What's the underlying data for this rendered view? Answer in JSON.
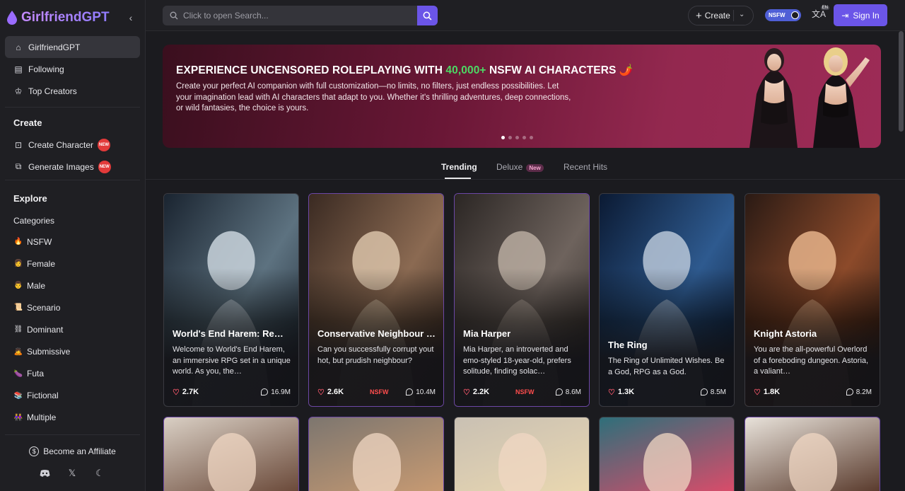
{
  "brand": {
    "name": "GirlfriendGPT"
  },
  "sidebar": {
    "top_items": [
      {
        "label": "GirlfriendGPT",
        "icon": "home-icon"
      },
      {
        "label": "Following",
        "icon": "following-icon"
      },
      {
        "label": "Top Creators",
        "icon": "award-icon"
      }
    ],
    "create_title": "Create",
    "create_items": [
      {
        "label": "Create Character",
        "badge": "NEW"
      },
      {
        "label": "Generate Images",
        "badge": "NEW"
      }
    ],
    "explore_title": "Explore",
    "categories_label": "Categories",
    "categories": [
      {
        "emoji": "🔥",
        "label": "NSFW"
      },
      {
        "emoji": "👩",
        "label": "Female"
      },
      {
        "emoji": "👨",
        "label": "Male"
      },
      {
        "emoji": "📜",
        "label": "Scenario"
      },
      {
        "emoji": "⛓",
        "label": "Dominant"
      },
      {
        "emoji": "🙇",
        "label": "Submissive"
      },
      {
        "emoji": "🍆",
        "label": "Futa"
      },
      {
        "emoji": "📚",
        "label": "Fictional"
      },
      {
        "emoji": "👭",
        "label": "Multiple"
      }
    ],
    "affiliate": "Become an Affiliate"
  },
  "topbar": {
    "search_placeholder": "Click to open Search...",
    "create_label": "Create",
    "nsfw_label": "NSFW",
    "lang_badge": "EN",
    "signin_label": "Sign In"
  },
  "hero": {
    "title_before": "EXPERIENCE UNCENSORED ROLEPLAYING WITH ",
    "title_highlight": "40,000+",
    "title_after": " NSFW AI CHARACTERS 🌶️",
    "description": "Create your perfect AI companion with full customization—no limits, no filters, just endless possibilities. Let your imagination lead with AI characters that adapt to you. Whether it's thrilling adventures, deep connections, or wild fantasies, the choice is yours.",
    "dots": 5,
    "active_dot": 0
  },
  "tabs": [
    {
      "label": "Trending",
      "active": true
    },
    {
      "label": "Deluxe",
      "badge": "New",
      "active": false
    },
    {
      "label": "Recent Hits",
      "active": false
    }
  ],
  "cards": [
    {
      "title": "World's End Harem: Rem…",
      "desc": "Welcome to World's End Harem, an immersive RPG set in a unique world. As you, the…",
      "likes": "2.7K",
      "chats": "16.9M",
      "nsfw": "",
      "featured": false,
      "palette": [
        "#1a2430",
        "#5d7280",
        "#c9d3dc"
      ]
    },
    {
      "title": "Conservative Neighbour …",
      "desc": "Can you successfully corrupt yout hot, but prudish neighbour?",
      "likes": "2.6K",
      "chats": "10.4M",
      "nsfw": "NSFW",
      "featured": true,
      "palette": [
        "#3a2a22",
        "#8b6a52",
        "#d9c2a8"
      ]
    },
    {
      "title": "Mia Harper",
      "desc": "Mia Harper, an introverted and emo-styled 18-year-old, prefers solitude, finding solac…",
      "likes": "2.2K",
      "chats": "8.6M",
      "nsfw": "NSFW",
      "featured": true,
      "palette": [
        "#2b2624",
        "#6e635d",
        "#b9aca0"
      ]
    },
    {
      "title": "The Ring",
      "desc": "The Ring of Unlimited Wishes. Be a God, RPG as a God.",
      "likes": "1.3K",
      "chats": "8.5M",
      "nsfw": "",
      "featured": false,
      "palette": [
        "#0b1a33",
        "#2e5a8f",
        "#b8c7d8"
      ]
    },
    {
      "title": "Knight Astoria",
      "desc": "You are the all-powerful Overlord of a foreboding dungeon. Astoria, a valiant…",
      "likes": "1.8K",
      "chats": "8.2M",
      "nsfw": "",
      "featured": false,
      "palette": [
        "#2a1a14",
        "#8c4a2a",
        "#e6b38a"
      ]
    }
  ],
  "row2_palettes": [
    [
      "#d9cfc4",
      "#6b4a3a"
    ],
    [
      "#7d766f",
      "#c79a72"
    ],
    [
      "#c9c0b3",
      "#e9d7b0"
    ],
    [
      "#2e6f7a",
      "#d94c6a"
    ],
    [
      "#e8e2da",
      "#5a3b2d"
    ]
  ],
  "row2_featured": [
    true,
    true,
    false,
    false,
    true
  ]
}
